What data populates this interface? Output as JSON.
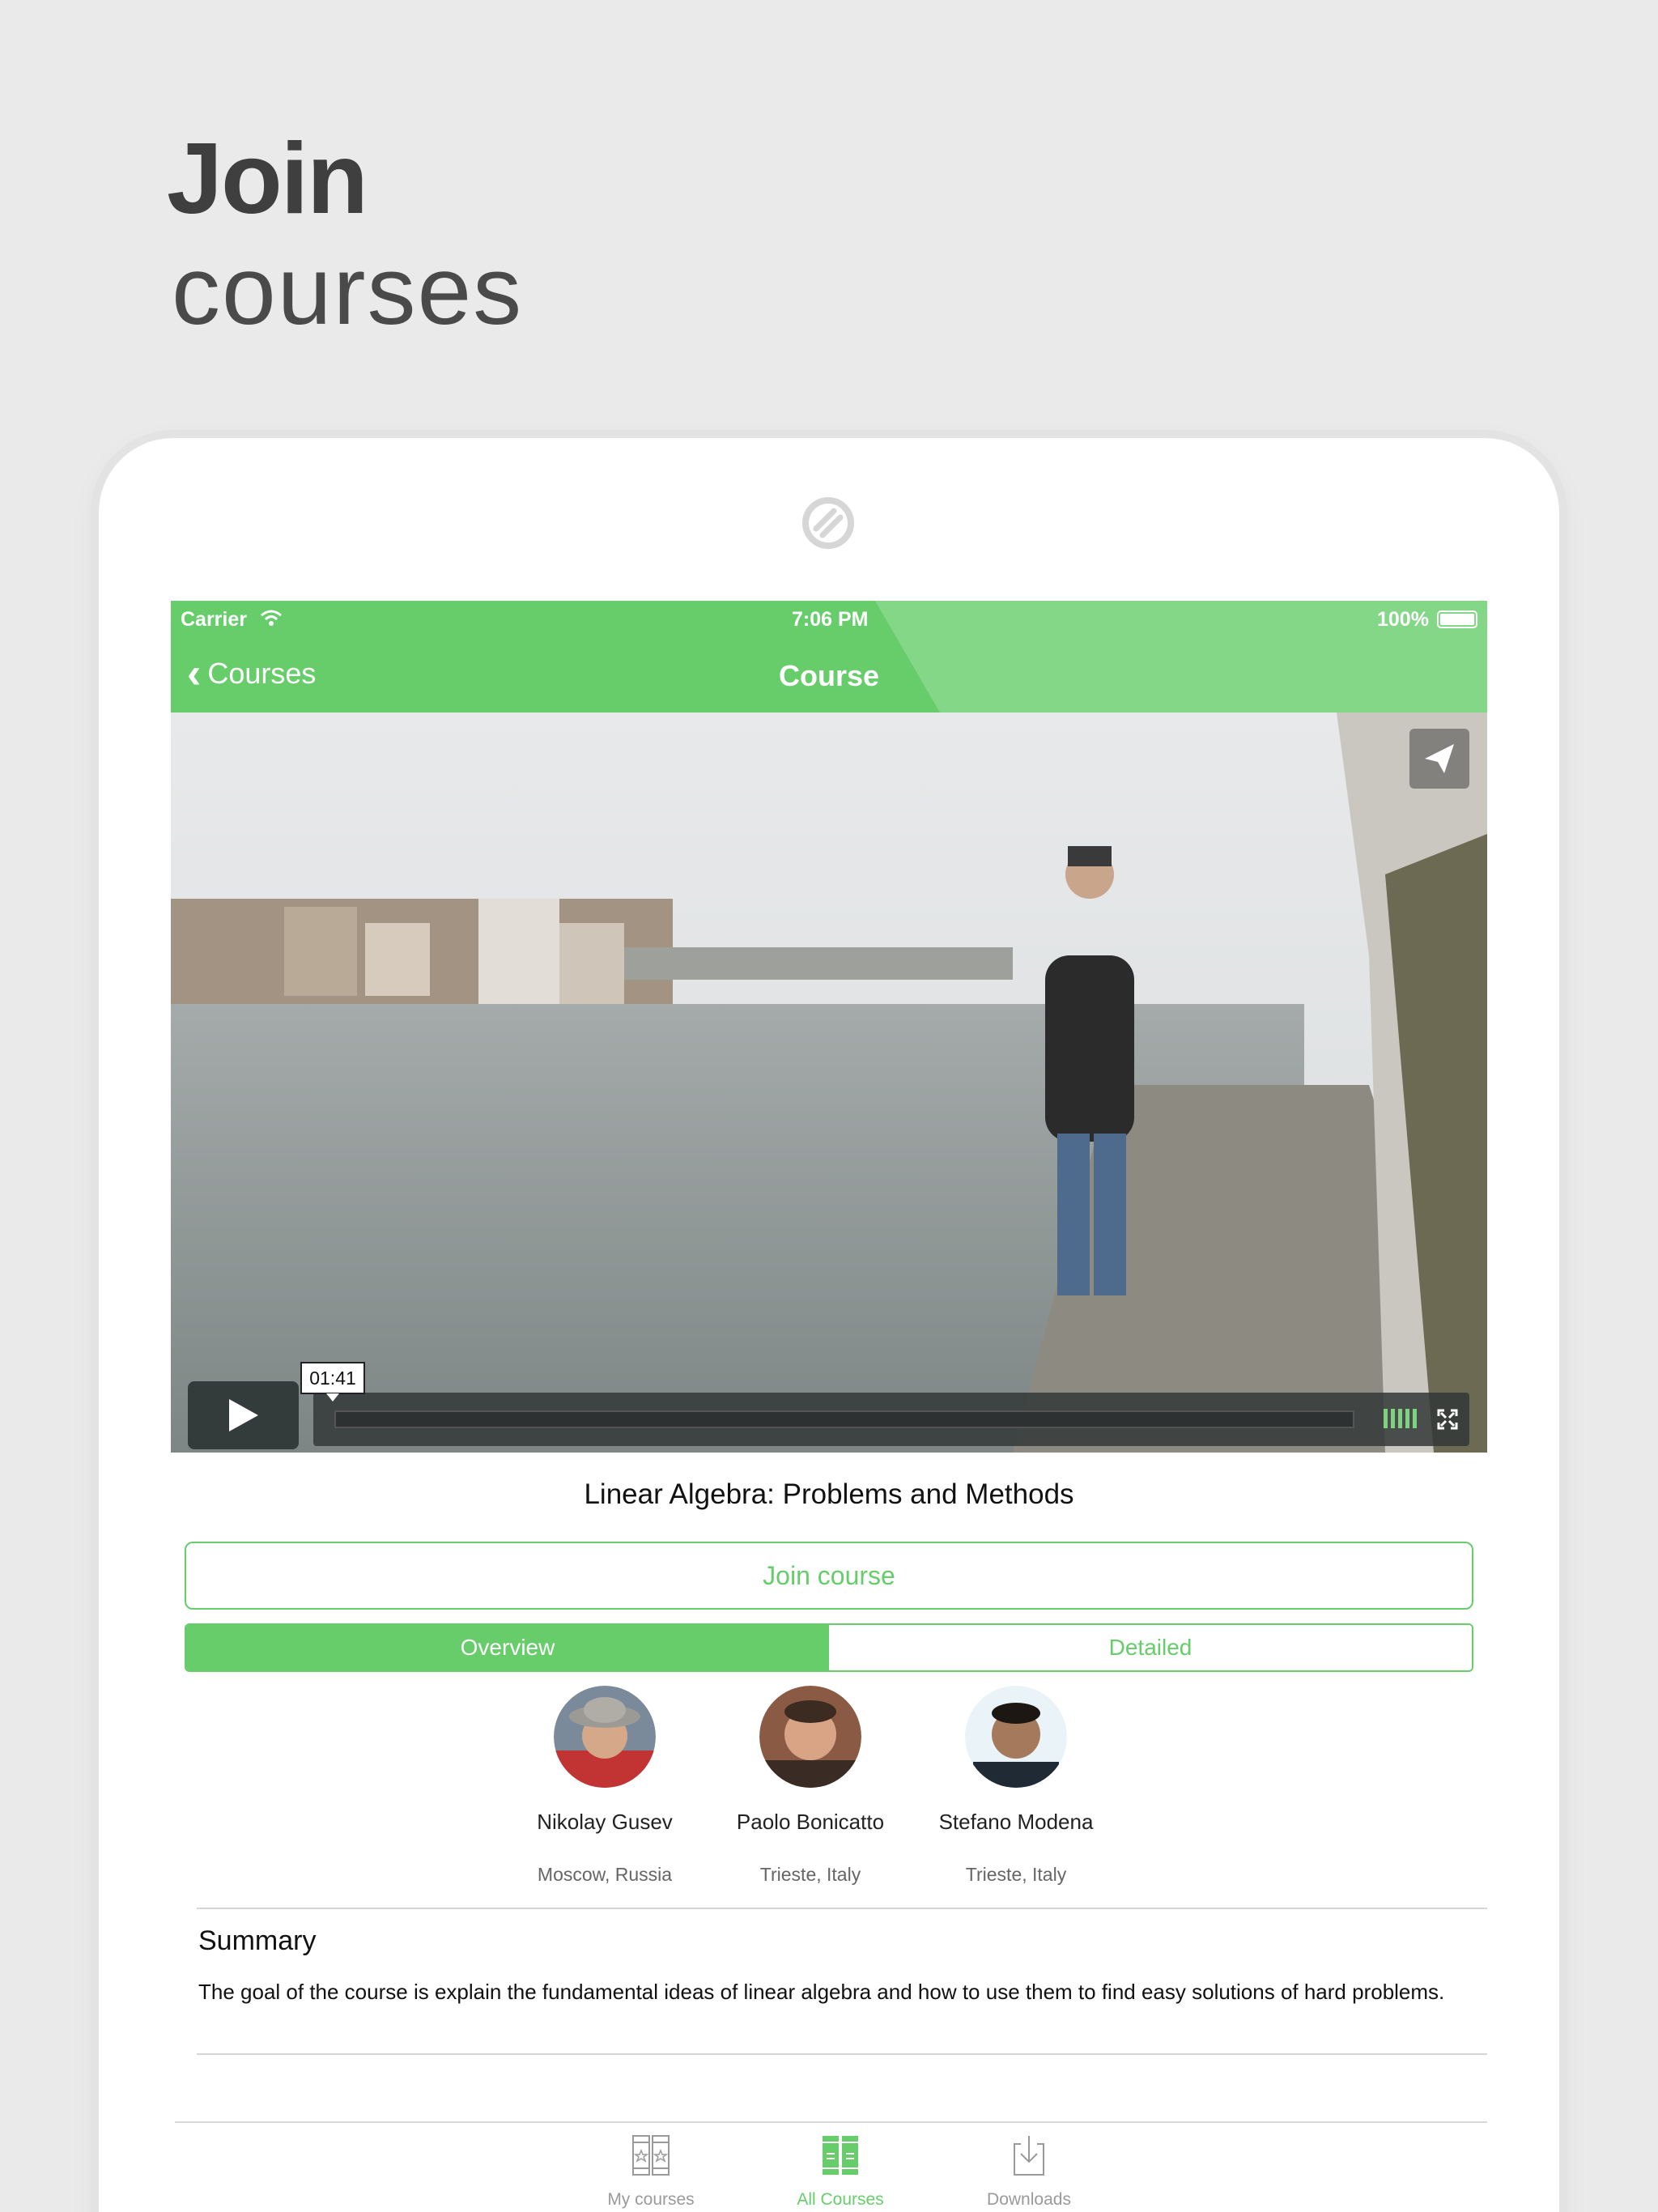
{
  "hero": {
    "line1": "Join",
    "line2": "courses"
  },
  "statusbar": {
    "carrier": "Carrier",
    "time": "7:06 PM",
    "battery": "100%"
  },
  "navbar": {
    "back_label": "Courses",
    "title": "Course"
  },
  "video": {
    "timestamp": "01:41",
    "progress": 0.0
  },
  "course": {
    "title": "Linear Algebra: Problems and Methods",
    "join_label": "Join course",
    "tabs": [
      {
        "label": "Overview",
        "active": true
      },
      {
        "label": "Detailed",
        "active": false
      }
    ]
  },
  "instructors": [
    {
      "name": "Nikolay Gusev",
      "location": "Moscow, Russia"
    },
    {
      "name": "Paolo Bonicatto",
      "location": "Trieste, Italy"
    },
    {
      "name": "Stefano Modena",
      "location": "Trieste, Italy"
    }
  ],
  "summary": {
    "heading": "Summary",
    "text": "The goal of the course is explain the fundamental ideas of linear algebra and how to use them to find easy solutions of hard problems."
  },
  "tabbar": {
    "items": [
      {
        "label": "My courses",
        "icon": "books-icon",
        "active": false
      },
      {
        "label": "All Courses",
        "icon": "books-filled-icon",
        "active": true
      },
      {
        "label": "Downloads",
        "icon": "download-icon",
        "active": false
      }
    ]
  },
  "colors": {
    "accent": "#67cd6b",
    "background": "#eaeaea",
    "text": "#222222"
  }
}
